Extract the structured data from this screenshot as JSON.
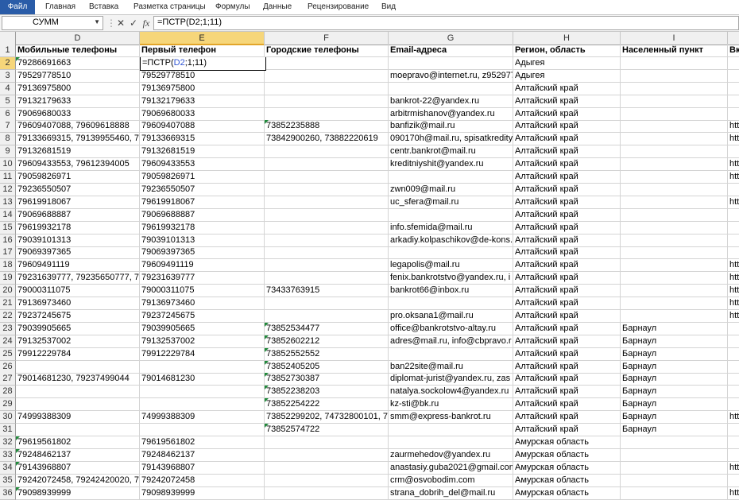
{
  "ribbon": {
    "tabs": [
      "Файл",
      "Главная",
      "Вставка",
      "Разметка страницы",
      "Формулы",
      "Данные",
      "Рецензирование",
      "Вид"
    ]
  },
  "formula_bar": {
    "name_box": "СУММ",
    "cancel": "✕",
    "enter": "✓",
    "fx": "fx",
    "formula": "=ПСТР(D2;1;11)"
  },
  "active_cell": {
    "prefix": "=ПСТР(",
    "ref": "D2",
    "suffix": ";1;11)"
  },
  "columns": [
    "D",
    "E",
    "F",
    "G",
    "H",
    "I",
    ""
  ],
  "header_row": [
    "Мобильные телефоны",
    "Первый телефон",
    "Городские телефоны",
    "Email-адреса",
    "Регион, область",
    "Населенный пункт",
    "Вк"
  ],
  "rows": [
    {
      "n": "2",
      "d": "79286691663",
      "e": "",
      "f": "",
      "g": "",
      "h": "Адыгея",
      "i": "",
      "j": "",
      "dt": true,
      "ft": false
    },
    {
      "n": "3",
      "d": "79529778510",
      "e": "79529778510",
      "f": "",
      "g": "moepravo@internet.ru, z952977",
      "h": "Адыгея",
      "i": "",
      "j": "",
      "dt": false,
      "ft": false
    },
    {
      "n": "4",
      "d": "79136975800",
      "e": "79136975800",
      "f": "",
      "g": "",
      "h": "Алтайский край",
      "i": "",
      "j": "",
      "dt": false,
      "ft": false
    },
    {
      "n": "5",
      "d": "79132179633",
      "e": "79132179633",
      "f": "",
      "g": "bankrot-22@yandex.ru",
      "h": "Алтайский край",
      "i": "",
      "j": "",
      "dt": false,
      "ft": false
    },
    {
      "n": "6",
      "d": "79069680033",
      "e": "79069680033",
      "f": "",
      "g": "arbitrmishanov@yandex.ru",
      "h": "Алтайский край",
      "i": "",
      "j": "",
      "dt": false,
      "ft": false
    },
    {
      "n": "7",
      "d": "79609407088, 79609618888",
      "e": "79609407088",
      "f": "73852235888",
      "g": "banfizik@mail.ru",
      "h": "Алтайский край",
      "i": "",
      "j": "htt",
      "dt": false,
      "ft": true
    },
    {
      "n": "8",
      "d": "79133669315, 79139955460, 7923",
      "e": "79133669315",
      "f": "73842900260, 73882220619",
      "g": "090170h@mail.ru, spisatkredity",
      "h": "Алтайский край",
      "i": "",
      "j": "htt",
      "dt": false,
      "ft": false
    },
    {
      "n": "9",
      "d": "79132681519",
      "e": "79132681519",
      "f": "",
      "g": "centr.bankrot@mail.ru",
      "h": "Алтайский край",
      "i": "",
      "j": "",
      "dt": false,
      "ft": false
    },
    {
      "n": "10",
      "d": "79609433553, 79612394005",
      "e": "79609433553",
      "f": "",
      "g": "kreditniyshit@yandex.ru",
      "h": "Алтайский край",
      "i": "",
      "j": "htt",
      "dt": false,
      "ft": false
    },
    {
      "n": "11",
      "d": "79059826971",
      "e": "79059826971",
      "f": "",
      "g": "",
      "h": "Алтайский край",
      "i": "",
      "j": "htt",
      "dt": false,
      "ft": false
    },
    {
      "n": "12",
      "d": "79236550507",
      "e": "79236550507",
      "f": "",
      "g": "zwn009@mail.ru",
      "h": "Алтайский край",
      "i": "",
      "j": "",
      "dt": false,
      "ft": false
    },
    {
      "n": "13",
      "d": "79619918067",
      "e": "79619918067",
      "f": "",
      "g": "uc_sfera@mail.ru",
      "h": "Алтайский край",
      "i": "",
      "j": "htt",
      "dt": false,
      "ft": false
    },
    {
      "n": "14",
      "d": "79069688887",
      "e": "79069688887",
      "f": "",
      "g": "",
      "h": "Алтайский край",
      "i": "",
      "j": "",
      "dt": false,
      "ft": false
    },
    {
      "n": "15",
      "d": "79619932178",
      "e": "79619932178",
      "f": "",
      "g": "info.sfemida@mail.ru",
      "h": "Алтайский край",
      "i": "",
      "j": "",
      "dt": false,
      "ft": false
    },
    {
      "n": "16",
      "d": "79039101313",
      "e": "79039101313",
      "f": "",
      "g": "arkadiy.kolpaschikov@de-kons.",
      "h": "Алтайский край",
      "i": "",
      "j": "",
      "dt": false,
      "ft": false
    },
    {
      "n": "17",
      "d": "79069397365",
      "e": "79069397365",
      "f": "",
      "g": "",
      "h": "Алтайский край",
      "i": "",
      "j": "",
      "dt": false,
      "ft": false
    },
    {
      "n": "18",
      "d": "79609491119",
      "e": "79609491119",
      "f": "",
      "g": "legapolis@mail.ru",
      "h": "Алтайский край",
      "i": "",
      "j": "htt",
      "dt": false,
      "ft": false
    },
    {
      "n": "19",
      "d": "79231639777, 79235650777, 7923",
      "e": "79231639777",
      "f": "",
      "g": "fenix.bankrotstvo@yandex.ru, i",
      "h": "Алтайский край",
      "i": "",
      "j": "htt",
      "dt": false,
      "ft": false
    },
    {
      "n": "20",
      "d": "79000311075",
      "e": "79000311075",
      "f": "73433763915",
      "g": "bankrot66@inbox.ru",
      "h": "Алтайский край",
      "i": "",
      "j": "htt",
      "dt": false,
      "ft": false
    },
    {
      "n": "21",
      "d": "79136973460",
      "e": "79136973460",
      "f": "",
      "g": "",
      "h": "Алтайский край",
      "i": "",
      "j": "htt",
      "dt": false,
      "ft": false
    },
    {
      "n": "22",
      "d": "79237245675",
      "e": "79237245675",
      "f": "",
      "g": "pro.oksana1@mail.ru",
      "h": "Алтайский край",
      "i": "",
      "j": "htt",
      "dt": false,
      "ft": false
    },
    {
      "n": "23",
      "d": "79039905665",
      "e": "79039905665",
      "f": "73852534477",
      "g": "office@bankrotstvo-altay.ru",
      "h": "Алтайский край",
      "i": "Барнаул",
      "j": "",
      "dt": false,
      "ft": true
    },
    {
      "n": "24",
      "d": "79132537002",
      "e": "79132537002",
      "f": "73852602212",
      "g": "adres@mail.ru, info@cbpravo.r",
      "h": "Алтайский край",
      "i": "Барнаул",
      "j": "",
      "dt": false,
      "ft": true
    },
    {
      "n": "25",
      "d": "79912229784",
      "e": "79912229784",
      "f": "73852552552",
      "g": "",
      "h": "Алтайский край",
      "i": "Барнаул",
      "j": "",
      "dt": false,
      "ft": true
    },
    {
      "n": "26",
      "d": "",
      "e": "",
      "f": "73852405205",
      "g": "ban22site@mail.ru",
      "h": "Алтайский край",
      "i": "Барнаул",
      "j": "",
      "dt": false,
      "ft": true
    },
    {
      "n": "27",
      "d": "79014681230, 79237499044",
      "e": "79014681230",
      "f": "73852730387",
      "g": "diplomat-jurist@yandex.ru, zas",
      "h": "Алтайский край",
      "i": "Барнаул",
      "j": "",
      "dt": false,
      "ft": true
    },
    {
      "n": "28",
      "d": "",
      "e": "",
      "f": "73852238203",
      "g": "natalya.sockolow4@yandex.ru",
      "h": "Алтайский край",
      "i": "Барнаул",
      "j": "",
      "dt": false,
      "ft": true
    },
    {
      "n": "29",
      "d": "",
      "e": "",
      "f": "73852254222",
      "g": "kz-sti@bk.ru",
      "h": "Алтайский край",
      "i": "Барнаул",
      "j": "",
      "dt": false,
      "ft": true
    },
    {
      "n": "30",
      "d": "74999388309",
      "e": "74999388309",
      "f": "73852299202, 74732800101, 7861",
      "g": "smm@express-bankrot.ru",
      "h": "Алтайский край",
      "i": "Барнаул",
      "j": "htt",
      "dt": false,
      "ft": false
    },
    {
      "n": "31",
      "d": "",
      "e": "",
      "f": "73852574722",
      "g": "",
      "h": "Алтайский край",
      "i": "Барнаул",
      "j": "",
      "dt": false,
      "ft": true
    },
    {
      "n": "32",
      "d": "79619561802",
      "e": "79619561802",
      "f": "",
      "g": "",
      "h": "Амурская область",
      "i": "",
      "j": "",
      "dt": true,
      "ft": false
    },
    {
      "n": "33",
      "d": "79248462137",
      "e": "79248462137",
      "f": "",
      "g": "zaurmehedov@yandex.ru",
      "h": "Амурская область",
      "i": "",
      "j": "",
      "dt": true,
      "ft": false
    },
    {
      "n": "34",
      "d": "79143968807",
      "e": "79143968807",
      "f": "",
      "g": "anastasiy.guba2021@gmail.com",
      "h": "Амурская область",
      "i": "",
      "j": "htt",
      "dt": true,
      "ft": false
    },
    {
      "n": "35",
      "d": "79242072458, 79242420020, 7924",
      "e": "79242072458",
      "f": "",
      "g": "crm@osvobodim.com",
      "h": "Амурская область",
      "i": "",
      "j": "",
      "dt": false,
      "ft": false
    },
    {
      "n": "36",
      "d": "79098939999",
      "e": "79098939999",
      "f": "",
      "g": "strana_dobrih_del@mail.ru",
      "h": "Амурская область",
      "i": "",
      "j": "htt",
      "dt": true,
      "ft": false
    }
  ],
  "colors": {
    "file_tab": "#2a5ca8",
    "selected_header": "#f6d67a",
    "comment_triangle": "#1f8a3a",
    "formula_reference": "#2f55d4"
  }
}
